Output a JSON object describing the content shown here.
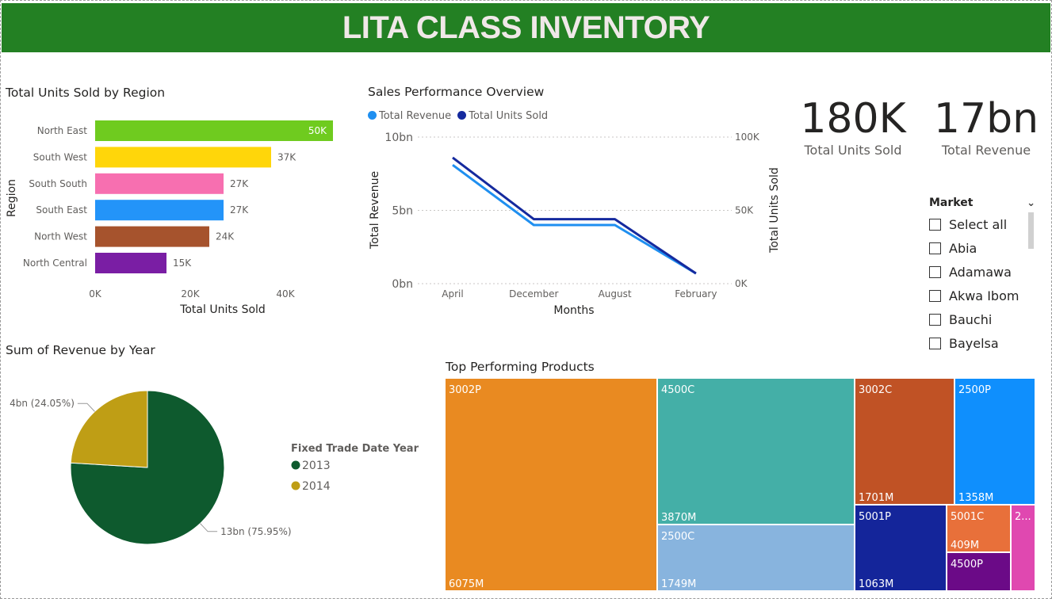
{
  "banner": {
    "title": "LITA CLASS INVENTORY"
  },
  "colors": {
    "banner_bg": "#238023"
  },
  "kpis": [
    {
      "value": "180K",
      "label": "Total Units Sold"
    },
    {
      "value": "17bn",
      "label": "Total Revenue"
    }
  ],
  "slicer": {
    "title": "Market",
    "options": [
      "Select all",
      "Abia",
      "Adamawa",
      "Akwa Ibom",
      "Bauchi",
      "Bayelsa"
    ]
  },
  "chart_data": [
    {
      "type": "bar",
      "orientation": "horizontal",
      "title": "Total Units Sold by Region",
      "xlabel": "Total Units Sold",
      "ylabel": "Region",
      "categories": [
        "North East",
        "South West",
        "South South",
        "South East",
        "North West",
        "North Central"
      ],
      "values": [
        50000,
        37000,
        27000,
        27000,
        24000,
        15000
      ],
      "data_labels": [
        "50K",
        "37K",
        "27K",
        "27K",
        "24K",
        "15K"
      ],
      "colors": [
        "#6fcb1f",
        "#ffd60a",
        "#f76fb0",
        "#2394f9",
        "#a6532d",
        "#7a1ea4"
      ],
      "xticks": [
        "0K",
        "20K",
        "40K"
      ],
      "xtick_values": [
        0,
        20000,
        40000
      ],
      "xlim": [
        0,
        50000
      ]
    },
    {
      "type": "line",
      "title": "Sales Performance Overview",
      "xlabel": "Months",
      "ylabel": "Total Revenue",
      "ylabel_right": "Total Units Sold",
      "categories": [
        "April",
        "December",
        "August",
        "February"
      ],
      "series": [
        {
          "name": "Total Revenue",
          "axis": "left",
          "color": "#1f8ff0",
          "values": [
            8.1,
            4.0,
            4.0,
            0.7
          ]
        },
        {
          "name": "Total Units Sold",
          "axis": "right",
          "color": "#152a9e",
          "values": [
            86000,
            44000,
            44000,
            7000
          ]
        }
      ],
      "yticks_left": [
        "0bn",
        "5bn",
        "10bn"
      ],
      "yticks_right": [
        "0K",
        "50K",
        "100K"
      ],
      "ylim_left": [
        0,
        10
      ],
      "ylim_right": [
        0,
        100000
      ],
      "grid": true,
      "legend": "top-left"
    },
    {
      "type": "pie",
      "title": "Sum of Revenue by Year",
      "legend_title": "Fixed Trade Date Year",
      "categories": [
        "2013",
        "2014"
      ],
      "values": [
        75.95,
        24.05
      ],
      "data_labels": [
        "13bn (75.95%)",
        "4bn (24.05%)"
      ],
      "colors": [
        "#0e5a2e",
        "#bf9e15"
      ],
      "legend": "right"
    },
    {
      "type": "treemap",
      "title": "Top Performing Products",
      "items": [
        {
          "name": "3002P",
          "value": 6075,
          "label": "6075M",
          "color": "#e98a21"
        },
        {
          "name": "4500C",
          "value": 3870,
          "label": "3870M",
          "color": "#44afa7"
        },
        {
          "name": "2500C",
          "value": 1749,
          "label": "1749M",
          "color": "#88b4de"
        },
        {
          "name": "3002C",
          "value": 1701,
          "label": "1701M",
          "color": "#c05225"
        },
        {
          "name": "2500P",
          "value": 1358,
          "label": "1358M",
          "color": "#0f8ffd"
        },
        {
          "name": "5001P",
          "value": 1063,
          "label": "1063M",
          "color": "#14259a"
        },
        {
          "name": "5001C",
          "value": 409,
          "label": "409M",
          "color": "#e8703a"
        },
        {
          "name": "4500P",
          "value": null,
          "label": "",
          "color": "#6b0a87"
        },
        {
          "name": "2...",
          "value": null,
          "label": "",
          "color": "#e048b0"
        }
      ]
    }
  ]
}
